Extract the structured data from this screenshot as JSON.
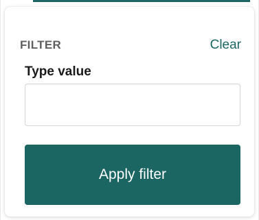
{
  "filter_panel": {
    "title": "FILTER",
    "clear_label": "Clear",
    "field_label": "Type value",
    "input_value": "",
    "input_placeholder": "",
    "apply_label": "Apply filter"
  },
  "colors": {
    "accent": "#1b6563",
    "title_gray": "#5f5f5f",
    "label_dark": "#1a1a1a",
    "input_border": "#d6d6d6",
    "button_text": "#ffffff"
  }
}
